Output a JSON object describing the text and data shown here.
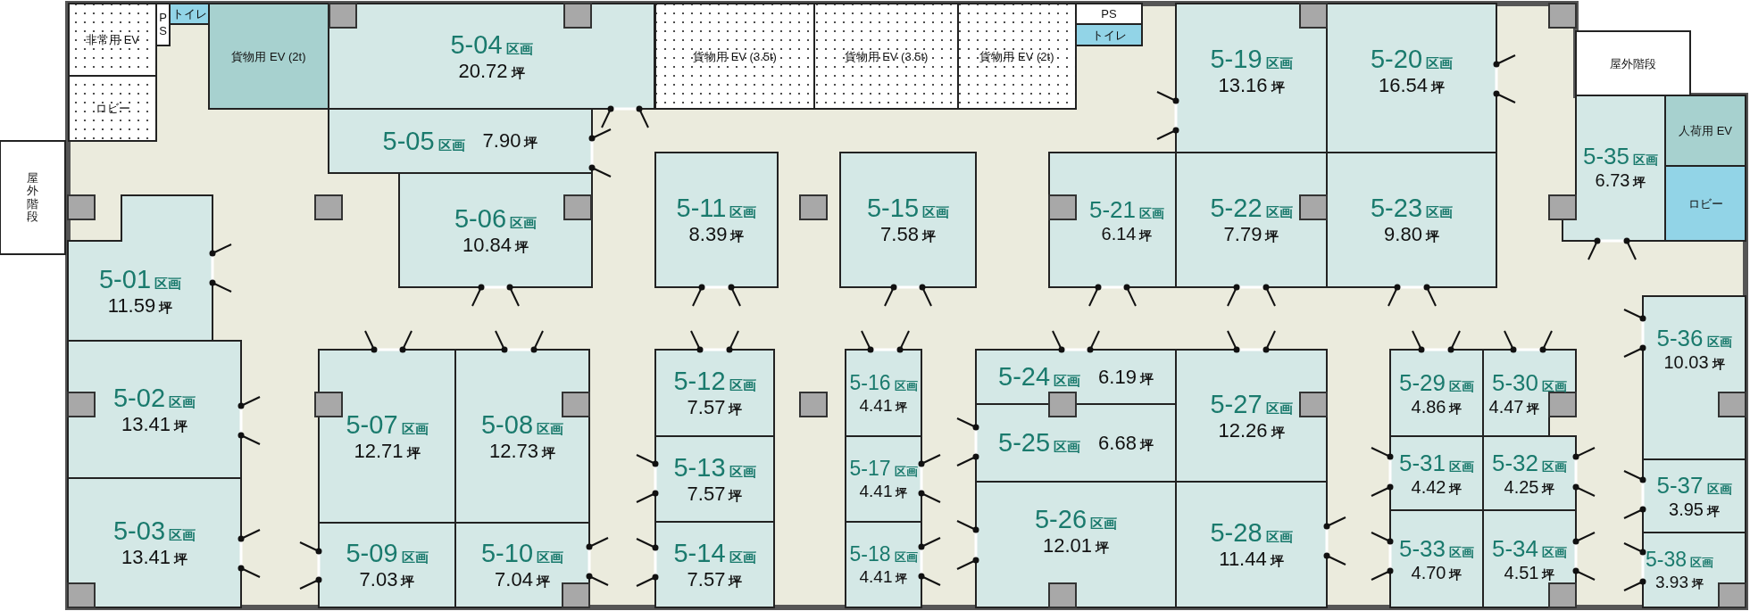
{
  "facilities": [
    {
      "label": "非常用 EV",
      "kind": "dotted"
    },
    {
      "label": "ロビー",
      "kind": "dotted"
    },
    {
      "label": "PS",
      "kind": "white"
    },
    {
      "label": "トイレ",
      "kind": "blue"
    },
    {
      "label": "貨物用 EV (2t)",
      "kind": "teal"
    },
    {
      "label": "貨物用 EV (3.5t)",
      "kind": "dotted"
    },
    {
      "label": "貨物用 EV (3.5t)",
      "kind": "dotted"
    },
    {
      "label": "貨物用 EV (2t)",
      "kind": "dotted"
    },
    {
      "label": "PS",
      "kind": "white"
    },
    {
      "label": "トイレ",
      "kind": "blue"
    },
    {
      "label": "屋外階段",
      "kind": "white"
    },
    {
      "label": "屋外階段",
      "kind": "white"
    },
    {
      "label": "人荷用 EV",
      "kind": "teal"
    },
    {
      "label": "ロビー",
      "kind": "blue"
    }
  ],
  "units": [
    {
      "id": "5-01",
      "suffix": "区画",
      "area": "11.59",
      "unit": "坪"
    },
    {
      "id": "5-02",
      "suffix": "区画",
      "area": "13.41",
      "unit": "坪"
    },
    {
      "id": "5-03",
      "suffix": "区画",
      "area": "13.41",
      "unit": "坪"
    },
    {
      "id": "5-04",
      "suffix": "区画",
      "area": "20.72",
      "unit": "坪"
    },
    {
      "id": "5-05",
      "suffix": "区画",
      "area": "7.90",
      "unit": "坪"
    },
    {
      "id": "5-06",
      "suffix": "区画",
      "area": "10.84",
      "unit": "坪"
    },
    {
      "id": "5-07",
      "suffix": "区画",
      "area": "12.71",
      "unit": "坪"
    },
    {
      "id": "5-08",
      "suffix": "区画",
      "area": "12.73",
      "unit": "坪"
    },
    {
      "id": "5-09",
      "suffix": "区画",
      "area": "7.03",
      "unit": "坪"
    },
    {
      "id": "5-10",
      "suffix": "区画",
      "area": "7.04",
      "unit": "坪"
    },
    {
      "id": "5-11",
      "suffix": "区画",
      "area": "8.39",
      "unit": "坪"
    },
    {
      "id": "5-12",
      "suffix": "区画",
      "area": "7.57",
      "unit": "坪"
    },
    {
      "id": "5-13",
      "suffix": "区画",
      "area": "7.57",
      "unit": "坪"
    },
    {
      "id": "5-14",
      "suffix": "区画",
      "area": "7.57",
      "unit": "坪"
    },
    {
      "id": "5-15",
      "suffix": "区画",
      "area": "7.58",
      "unit": "坪"
    },
    {
      "id": "5-16",
      "suffix": "区画",
      "area": "4.41",
      "unit": "坪"
    },
    {
      "id": "5-17",
      "suffix": "区画",
      "area": "4.41",
      "unit": "坪"
    },
    {
      "id": "5-18",
      "suffix": "区画",
      "area": "4.41",
      "unit": "坪"
    },
    {
      "id": "5-19",
      "suffix": "区画",
      "area": "13.16",
      "unit": "坪"
    },
    {
      "id": "5-20",
      "suffix": "区画",
      "area": "16.54",
      "unit": "坪"
    },
    {
      "id": "5-21",
      "suffix": "区画",
      "area": "6.14",
      "unit": "坪"
    },
    {
      "id": "5-22",
      "suffix": "区画",
      "area": "7.79",
      "unit": "坪"
    },
    {
      "id": "5-23",
      "suffix": "区画",
      "area": "9.80",
      "unit": "坪"
    },
    {
      "id": "5-24",
      "suffix": "区画",
      "area": "6.19",
      "unit": "坪"
    },
    {
      "id": "5-25",
      "suffix": "区画",
      "area": "6.68",
      "unit": "坪"
    },
    {
      "id": "5-26",
      "suffix": "区画",
      "area": "12.01",
      "unit": "坪"
    },
    {
      "id": "5-27",
      "suffix": "区画",
      "area": "12.26",
      "unit": "坪"
    },
    {
      "id": "5-28",
      "suffix": "区画",
      "area": "11.44",
      "unit": "坪"
    },
    {
      "id": "5-29",
      "suffix": "区画",
      "area": "4.86",
      "unit": "坪"
    },
    {
      "id": "5-30",
      "suffix": "区画",
      "area": "4.47",
      "unit": "坪"
    },
    {
      "id": "5-31",
      "suffix": "区画",
      "area": "4.42",
      "unit": "坪"
    },
    {
      "id": "5-32",
      "suffix": "区画",
      "area": "4.25",
      "unit": "坪"
    },
    {
      "id": "5-33",
      "suffix": "区画",
      "area": "4.70",
      "unit": "坪"
    },
    {
      "id": "5-34",
      "suffix": "区画",
      "area": "4.51",
      "unit": "坪"
    },
    {
      "id": "5-35",
      "suffix": "区画",
      "area": "6.73",
      "unit": "坪"
    },
    {
      "id": "5-36",
      "suffix": "区画",
      "area": "10.03",
      "unit": "坪"
    },
    {
      "id": "5-37",
      "suffix": "区画",
      "area": "3.95",
      "unit": "坪"
    },
    {
      "id": "5-38",
      "suffix": "区画",
      "area": "3.93",
      "unit": "坪"
    }
  ]
}
